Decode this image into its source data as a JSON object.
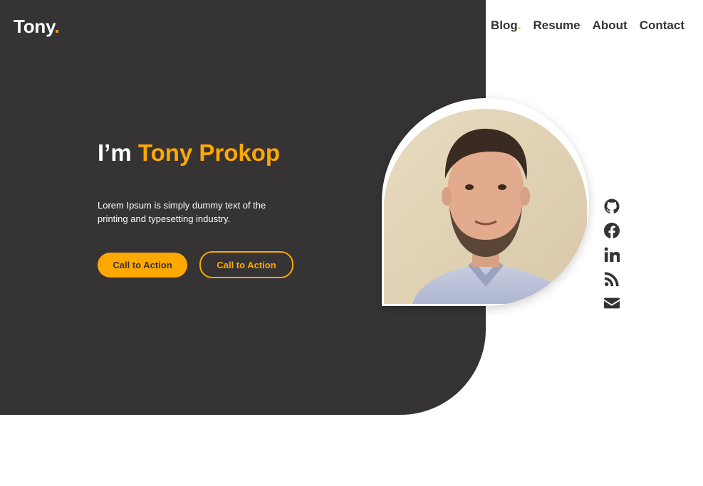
{
  "brand": {
    "name": "Tony",
    "dot": ".",
    "accent_color": "#ffa800"
  },
  "nav": {
    "items": [
      {
        "label": "Blog"
      },
      {
        "label": "Resume"
      },
      {
        "label": "About"
      },
      {
        "label": "Contact"
      }
    ],
    "separator": "."
  },
  "hero": {
    "headline_prefix": "I’m ",
    "headline_name": "Tony Prokop",
    "intro": "Lorem Ipsum is simply dummy text of the printing and typesetting industry.",
    "primary_cta": "Call to Action",
    "secondary_cta": "Call to Action",
    "background_color": "#353334"
  },
  "socials": [
    {
      "icon": "github-icon"
    },
    {
      "icon": "facebook-icon"
    },
    {
      "icon": "linkedin-icon"
    },
    {
      "icon": "rss-icon"
    },
    {
      "icon": "mail-icon"
    }
  ]
}
